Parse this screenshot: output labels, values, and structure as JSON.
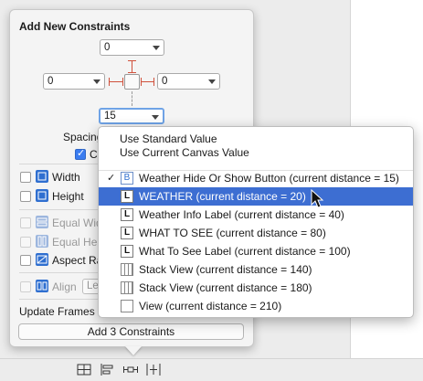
{
  "popover": {
    "title": "Add New Constraints",
    "top_value": "0",
    "left_value": "0",
    "right_value": "0",
    "bottom_value": "15",
    "spacing_label": "Spacing",
    "constrain_label": "Co",
    "rows": {
      "width_label": "Width",
      "height_label": "Height",
      "equal_widths_label": "Equal Wid",
      "equal_heights_label": "Equal Heig",
      "aspect_ratio_label": "Aspect Ra",
      "align_label": "Align",
      "align_value": "Le"
    },
    "update_frames_label": "Update Frames",
    "add_button_label": "Add 3 Constraints"
  },
  "menu": {
    "top_items": [
      {
        "label": "Use Standard Value"
      },
      {
        "label": "Use Current Canvas Value"
      }
    ],
    "items": [
      {
        "label": "Weather Hide Or Show Button (current distance = 15)",
        "icon": "button-icon",
        "glyph": "B",
        "checked": true,
        "selected": false
      },
      {
        "label": "WEATHER (current distance = 20)",
        "icon": "label-icon",
        "glyph": "L",
        "checked": false,
        "selected": true
      },
      {
        "label": "Weather Info Label (current distance = 40)",
        "icon": "label-icon",
        "glyph": "L",
        "checked": false,
        "selected": false
      },
      {
        "label": "WHAT TO SEE (current distance = 80)",
        "icon": "label-icon",
        "glyph": "L",
        "checked": false,
        "selected": false
      },
      {
        "label": "What To See Label (current distance = 100)",
        "icon": "label-icon",
        "glyph": "L",
        "checked": false,
        "selected": false
      },
      {
        "label": "Stack View (current distance = 140)",
        "icon": "stack-view-icon",
        "glyph": "",
        "checked": false,
        "selected": false
      },
      {
        "label": "Stack View (current distance = 180)",
        "icon": "stack-view-icon",
        "glyph": "",
        "checked": false,
        "selected": false
      },
      {
        "label": "View (current distance = 210)",
        "icon": "view-icon",
        "glyph": "",
        "checked": false,
        "selected": false
      }
    ],
    "checkmark": "✓"
  },
  "colors": {
    "selection": "#3d6ed2",
    "strut": "#d0503b",
    "accent_blue": "#2f6fd0"
  }
}
